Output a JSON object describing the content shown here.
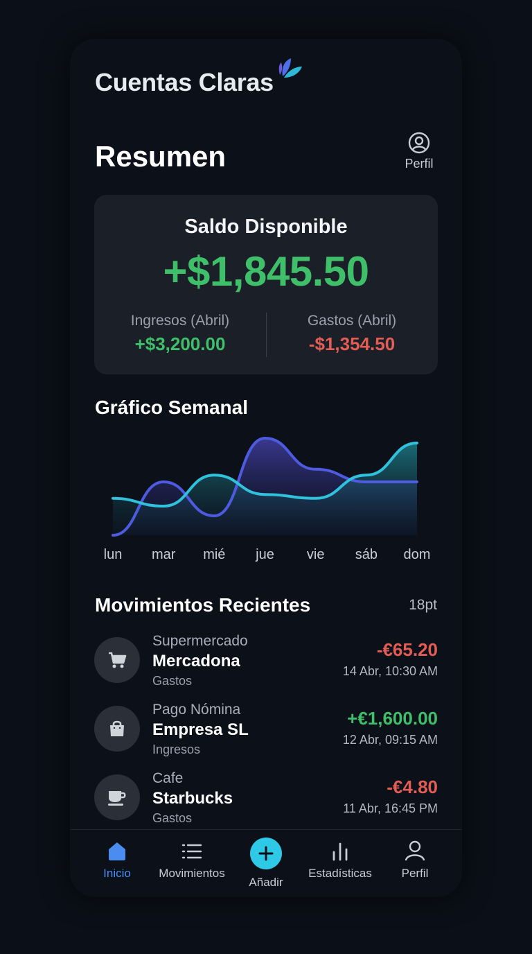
{
  "app": {
    "brand": "Cuentas Claras"
  },
  "header": {
    "title": "Resumen",
    "profile_label": "Perfil"
  },
  "balance": {
    "label": "Saldo Disponible",
    "amount": "+$1,845.50",
    "income_label": "Ingresos (Abril)",
    "income_value": "+$3,200.00",
    "expense_label": "Gastos (Abril)",
    "expense_value": "-$1,354.50"
  },
  "weekly": {
    "title": "Gráfico Semanal",
    "chart_data": {
      "type": "area",
      "categories": [
        "lun",
        "mar",
        "mié",
        "jue",
        "vie",
        "sáb",
        "dom"
      ],
      "series": [
        {
          "values": [
            0.0,
            0.55,
            0.2,
            1.0,
            0.68,
            0.55,
            0.55
          ],
          "color": "#4e5be0"
        },
        {
          "values": [
            0.38,
            0.3,
            0.62,
            0.42,
            0.38,
            0.62,
            0.95
          ],
          "color": "#30c2dc"
        }
      ],
      "ylim": [
        0,
        1
      ],
      "grid": false
    }
  },
  "movements": {
    "title": "Movimientos Recientes",
    "meta": "18pt",
    "items": [
      {
        "category": "Supermercado",
        "name": "Mercadona",
        "type": "Gastos",
        "amount": "-€65.20",
        "date": "14 Abr, 10:30 AM",
        "positive": false,
        "icon": "cart-icon"
      },
      {
        "category": "Pago Nómina",
        "name": "Empresa SL",
        "type": "Ingresos",
        "amount": "+€1,600.00",
        "date": "12 Abr, 09:15 AM",
        "positive": true,
        "icon": "bag-icon"
      },
      {
        "category": "Cafe",
        "name": "Starbucks",
        "type": "Gastos",
        "amount": "-€4.80",
        "date": "11 Abr, 16:45 PM",
        "positive": false,
        "icon": "coffee-icon"
      }
    ]
  },
  "nav": {
    "home": "Inicio",
    "movements": "Movimientos",
    "add": "Añadir",
    "stats": "Estadísticas",
    "profile": "Perfil"
  },
  "colors": {
    "positive": "#3fbf6a",
    "negative": "#e35d55",
    "accent": "#4b8cf0",
    "add_button": "#2ec9e6"
  }
}
